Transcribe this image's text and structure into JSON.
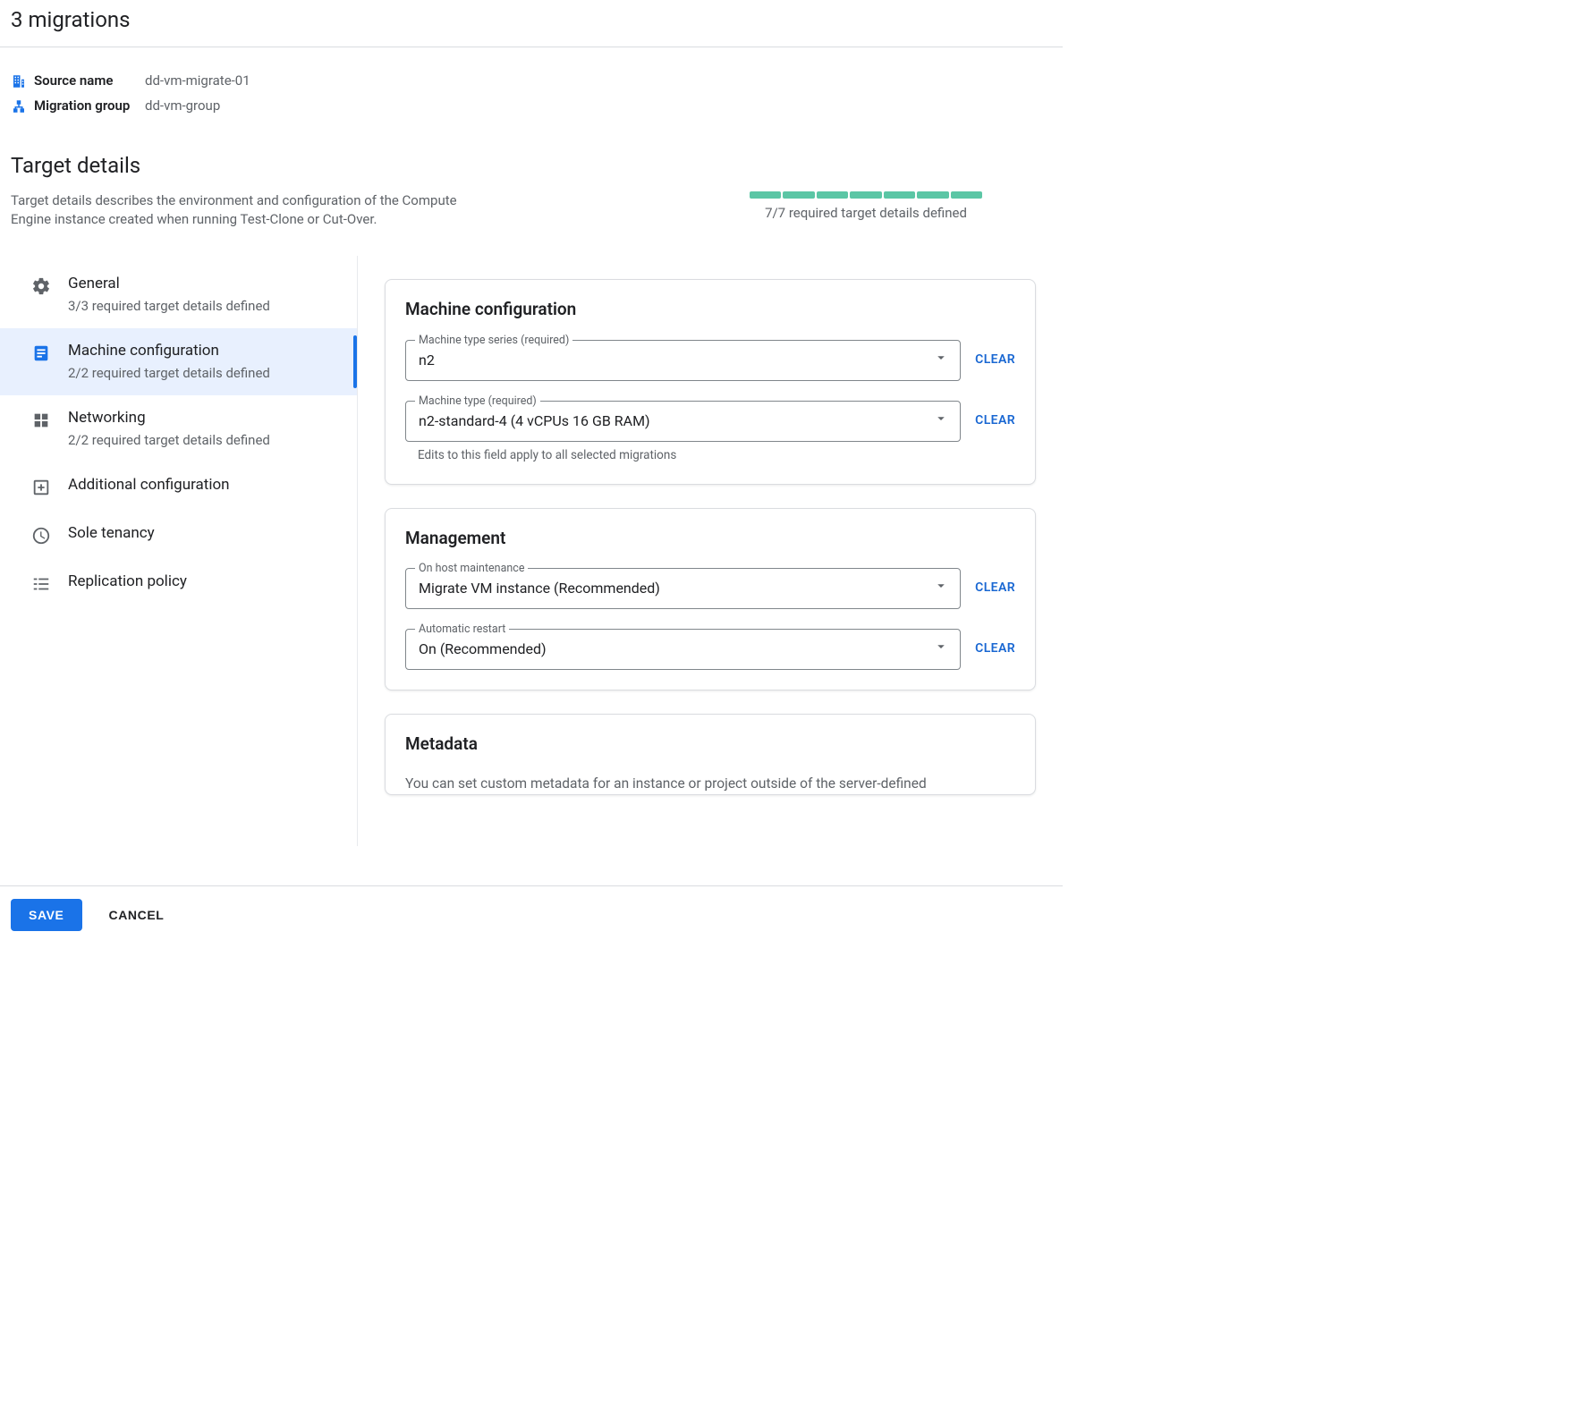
{
  "header": {
    "title": "3 migrations"
  },
  "meta": {
    "source_name_label": "Source name",
    "source_name_value": "dd-vm-migrate-01",
    "migration_group_label": "Migration group",
    "migration_group_value": "dd-vm-group"
  },
  "target_details": {
    "heading": "Target details",
    "description": "Target details describes the environment and configuration of the Compute Engine instance created when running Test-Clone or Cut-Over.",
    "progress": {
      "defined": 7,
      "total": 7,
      "label": "7/7 required target details defined"
    }
  },
  "sidebar": {
    "items": [
      {
        "id": "general",
        "title": "General",
        "sub": "3/3 required target details defined"
      },
      {
        "id": "machine",
        "title": "Machine configuration",
        "sub": "2/2 required target details defined"
      },
      {
        "id": "networking",
        "title": "Networking",
        "sub": "2/2 required target details defined"
      },
      {
        "id": "additional",
        "title": "Additional configuration",
        "sub": ""
      },
      {
        "id": "sole",
        "title": "Sole tenancy",
        "sub": ""
      },
      {
        "id": "replication",
        "title": "Replication policy",
        "sub": ""
      }
    ],
    "selected": "machine"
  },
  "cards": {
    "machine_config": {
      "heading": "Machine configuration",
      "fields": {
        "series": {
          "legend": "Machine type series (required)",
          "value": "n2",
          "clear": "CLEAR"
        },
        "type": {
          "legend": "Machine type (required)",
          "value": "n2-standard-4 (4 vCPUs 16 GB RAM)",
          "clear": "CLEAR",
          "help": "Edits to this field apply to all selected migrations"
        }
      }
    },
    "management": {
      "heading": "Management",
      "fields": {
        "maintenance": {
          "legend": "On host maintenance",
          "value": "Migrate VM instance (Recommended)",
          "clear": "CLEAR"
        },
        "restart": {
          "legend": "Automatic restart",
          "value": "On (Recommended)",
          "clear": "CLEAR"
        }
      }
    },
    "metadata": {
      "heading": "Metadata",
      "text": "You can set custom metadata for an instance or project outside of the server-defined"
    }
  },
  "footer": {
    "save": "SAVE",
    "cancel": "CANCEL"
  }
}
